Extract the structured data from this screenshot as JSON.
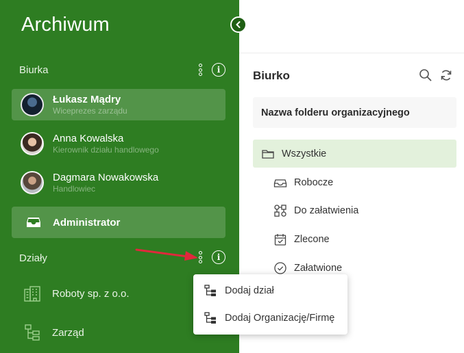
{
  "app_title": "Archiwum",
  "sidebar": {
    "desks_label": "Biurka",
    "people": [
      {
        "name": "Łukasz Mądry",
        "role": "Wiceprezes zarządu",
        "active": true
      },
      {
        "name": "Anna Kowalska",
        "role": "Kierownik działu handlowego",
        "active": false
      },
      {
        "name": "Dagmara Nowakowska",
        "role": "Handlowiec",
        "active": false
      }
    ],
    "admin_label": "Administrator",
    "departments_label": "Działy",
    "departments": [
      {
        "label": "Roboty sp. z o.o.",
        "icon": "building-icon"
      },
      {
        "label": "Zarząd",
        "icon": "org-tree-icon"
      }
    ]
  },
  "panel": {
    "title": "Biurko",
    "folder_header": "Nazwa folderu organizacyjnego",
    "folders": [
      {
        "label": "Wszystkie",
        "icon": "folder-icon",
        "selected": true
      },
      {
        "label": "Robocze",
        "icon": "inbox-icon"
      },
      {
        "label": "Do załatwienia",
        "icon": "workflow-icon"
      },
      {
        "label": "Zlecone",
        "icon": "calendar-check-icon"
      },
      {
        "label": "Załatwione",
        "icon": "check-circle-icon"
      }
    ]
  },
  "popup_menu": {
    "items": [
      {
        "label": "Dodaj dział",
        "icon": "org-tree-icon"
      },
      {
        "label": "Dodaj Organizację/Firmę",
        "icon": "org-tree-icon"
      }
    ]
  },
  "colors": {
    "sidebar_bg": "#2e7d22",
    "selected_folder_bg": "#e3f1dc",
    "arrow": "#e0283c"
  }
}
